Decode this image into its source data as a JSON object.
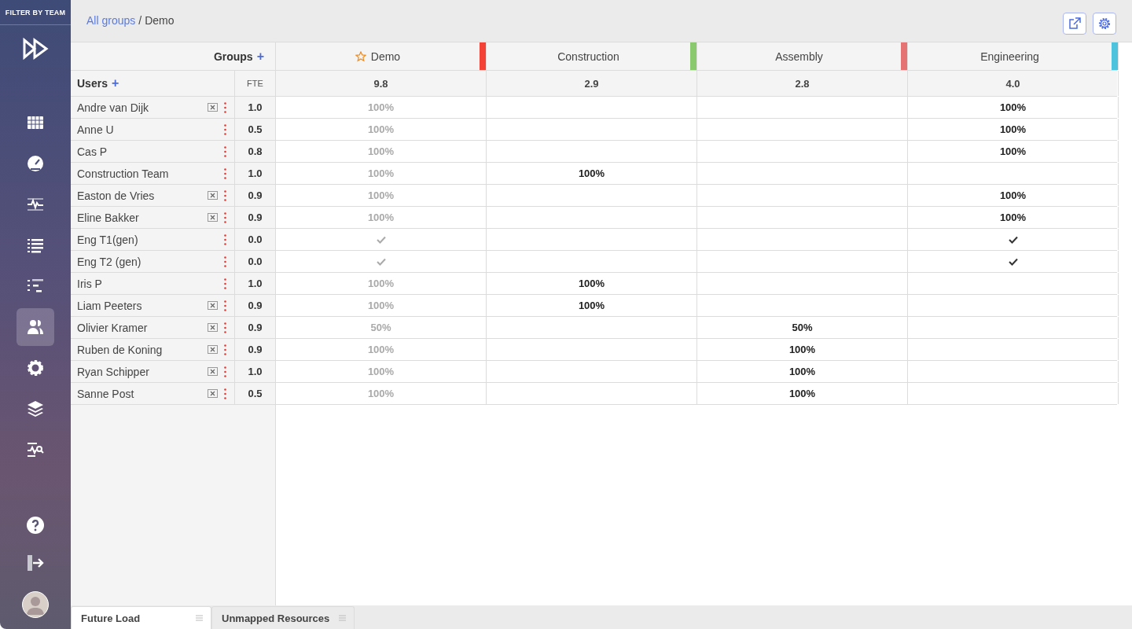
{
  "sidebar": {
    "filter_label": "FILTER BY TEAM",
    "nav_items": [
      {
        "selected": false
      },
      {
        "selected": false
      },
      {
        "selected": false
      },
      {
        "selected": false
      },
      {
        "selected": false
      },
      {
        "selected": true
      },
      {
        "selected": false
      },
      {
        "selected": false
      },
      {
        "selected": false
      }
    ]
  },
  "breadcrumb": {
    "parent": "All groups",
    "separator": "/",
    "current": "Demo"
  },
  "groups_label": "Groups",
  "add_group": "+",
  "users_label": "Users",
  "add_user": "+",
  "fte_label": "FTE",
  "groups": [
    {
      "name": "Demo",
      "starred": true,
      "color": "#f44336",
      "total": "9.8"
    },
    {
      "name": "Construction",
      "starred": false,
      "color": "#8bc96e",
      "total": "2.9"
    },
    {
      "name": "Assembly",
      "starred": false,
      "color": "#e57373",
      "total": "2.8"
    },
    {
      "name": "Engineering",
      "starred": false,
      "color": "#4ec3dd",
      "total": "4.0"
    }
  ],
  "users": [
    {
      "name": "Andre van Dijk",
      "removable": true,
      "fte": "1.0",
      "cells": [
        {
          "kind": "text",
          "value": "100%"
        },
        {
          "kind": "empty"
        },
        {
          "kind": "empty"
        },
        {
          "kind": "text",
          "value": "100%"
        }
      ]
    },
    {
      "name": "Anne U",
      "removable": false,
      "fte": "0.5",
      "cells": [
        {
          "kind": "text",
          "value": "100%"
        },
        {
          "kind": "empty"
        },
        {
          "kind": "empty"
        },
        {
          "kind": "text",
          "value": "100%"
        }
      ]
    },
    {
      "name": "Cas P",
      "removable": false,
      "fte": "0.8",
      "cells": [
        {
          "kind": "text",
          "value": "100%"
        },
        {
          "kind": "empty"
        },
        {
          "kind": "empty"
        },
        {
          "kind": "text",
          "value": "100%"
        }
      ]
    },
    {
      "name": "Construction Team",
      "removable": false,
      "fte": "1.0",
      "cells": [
        {
          "kind": "text",
          "value": "100%"
        },
        {
          "kind": "text",
          "value": "100%"
        },
        {
          "kind": "empty"
        },
        {
          "kind": "empty"
        }
      ]
    },
    {
      "name": "Easton de Vries",
      "removable": true,
      "fte": "0.9",
      "cells": [
        {
          "kind": "text",
          "value": "100%"
        },
        {
          "kind": "empty"
        },
        {
          "kind": "empty"
        },
        {
          "kind": "text",
          "value": "100%"
        }
      ]
    },
    {
      "name": "Eline Bakker",
      "removable": true,
      "fte": "0.9",
      "cells": [
        {
          "kind": "text",
          "value": "100%"
        },
        {
          "kind": "empty"
        },
        {
          "kind": "empty"
        },
        {
          "kind": "text",
          "value": "100%"
        }
      ]
    },
    {
      "name": "Eng T1(gen)",
      "removable": false,
      "fte": "0.0",
      "cells": [
        {
          "kind": "check"
        },
        {
          "kind": "empty"
        },
        {
          "kind": "empty"
        },
        {
          "kind": "check"
        }
      ]
    },
    {
      "name": "Eng T2 (gen)",
      "removable": false,
      "fte": "0.0",
      "cells": [
        {
          "kind": "check"
        },
        {
          "kind": "empty"
        },
        {
          "kind": "empty"
        },
        {
          "kind": "check"
        }
      ]
    },
    {
      "name": "Iris P",
      "removable": false,
      "fte": "1.0",
      "cells": [
        {
          "kind": "text",
          "value": "100%"
        },
        {
          "kind": "text",
          "value": "100%"
        },
        {
          "kind": "empty"
        },
        {
          "kind": "empty"
        }
      ]
    },
    {
      "name": "Liam Peeters",
      "removable": true,
      "fte": "0.9",
      "cells": [
        {
          "kind": "text",
          "value": "100%"
        },
        {
          "kind": "text",
          "value": "100%"
        },
        {
          "kind": "empty"
        },
        {
          "kind": "empty"
        }
      ]
    },
    {
      "name": "Olivier Kramer",
      "removable": true,
      "fte": "0.9",
      "cells": [
        {
          "kind": "text",
          "value": "50%"
        },
        {
          "kind": "empty"
        },
        {
          "kind": "text",
          "value": "50%"
        },
        {
          "kind": "empty"
        }
      ]
    },
    {
      "name": "Ruben de Koning",
      "removable": true,
      "fte": "0.9",
      "cells": [
        {
          "kind": "text",
          "value": "100%"
        },
        {
          "kind": "empty"
        },
        {
          "kind": "text",
          "value": "100%"
        },
        {
          "kind": "empty"
        }
      ]
    },
    {
      "name": "Ryan Schipper",
      "removable": true,
      "fte": "1.0",
      "cells": [
        {
          "kind": "text",
          "value": "100%"
        },
        {
          "kind": "empty"
        },
        {
          "kind": "text",
          "value": "100%"
        },
        {
          "kind": "empty"
        }
      ]
    },
    {
      "name": "Sanne Post",
      "removable": true,
      "fte": "0.5",
      "cells": [
        {
          "kind": "text",
          "value": "100%"
        },
        {
          "kind": "empty"
        },
        {
          "kind": "text",
          "value": "100%"
        },
        {
          "kind": "empty"
        }
      ]
    }
  ],
  "bottom_tabs": [
    {
      "label": "Future Load",
      "selected": true
    },
    {
      "label": "Unmapped Resources",
      "selected": false
    }
  ]
}
